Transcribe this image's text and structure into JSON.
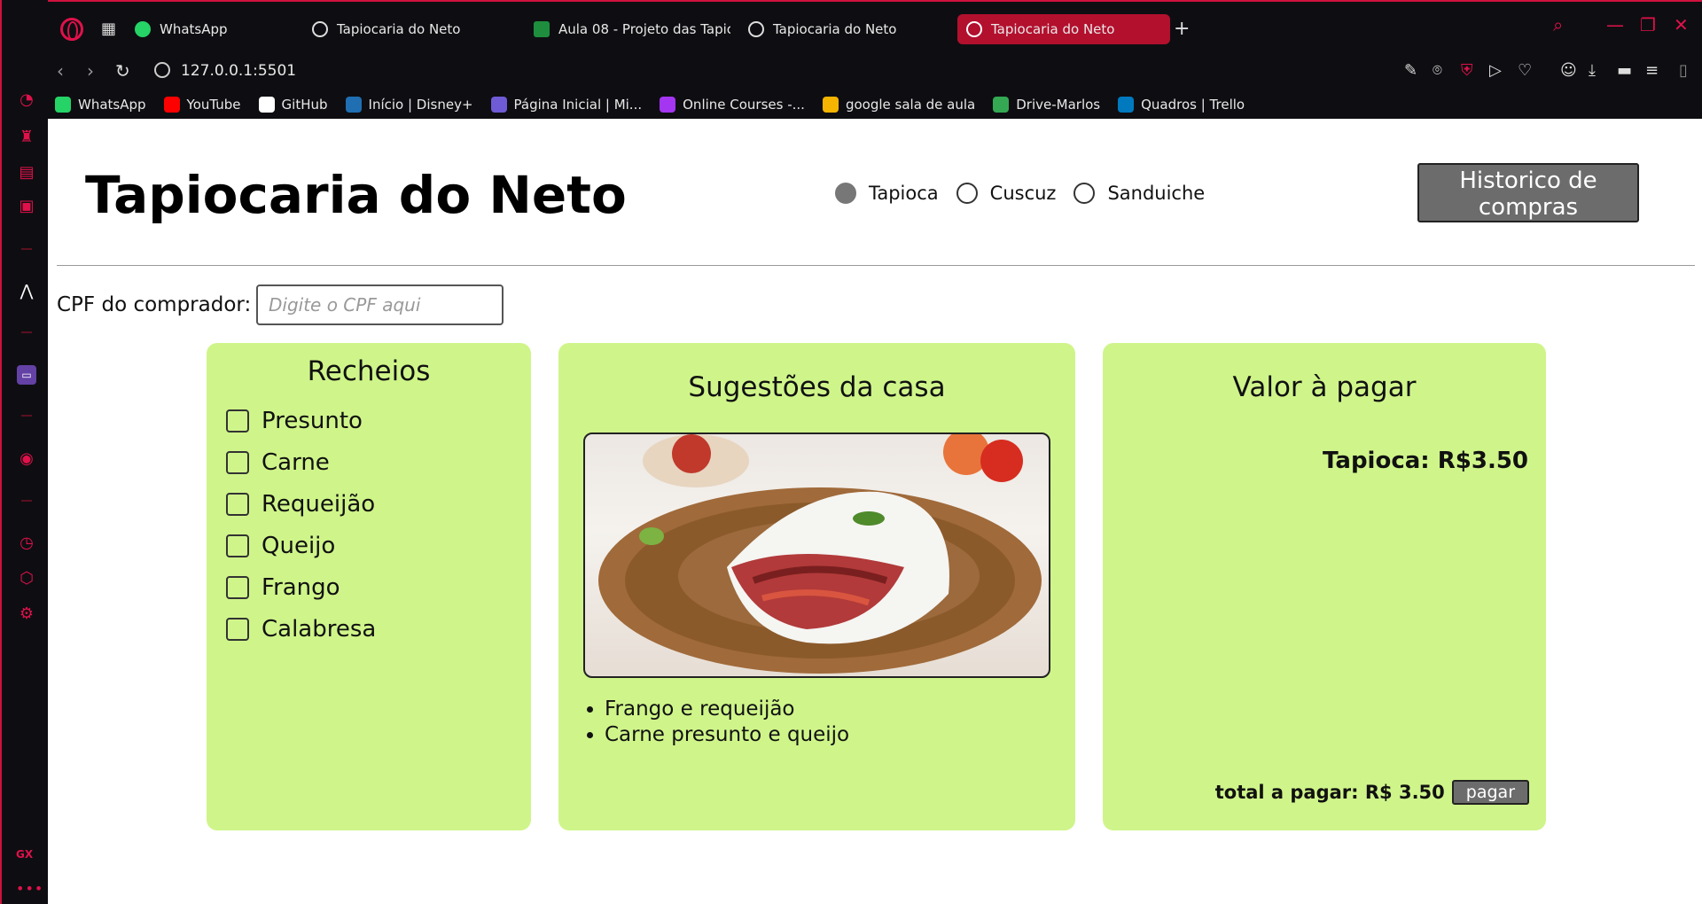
{
  "browser": {
    "tabs": [
      {
        "label": "WhatsApp",
        "icon": "whatsapp-icon",
        "active": false
      },
      {
        "label": "Tapiocaria do Neto",
        "icon": "globe-icon",
        "active": false
      },
      {
        "label": "Aula 08 - Projeto das Tapic",
        "icon": "classroom-icon",
        "active": false
      },
      {
        "label": "Tapiocaria do Neto",
        "icon": "globe-icon",
        "active": false
      },
      {
        "label": "Tapiocaria do Neto",
        "icon": "globe-icon",
        "active": true
      }
    ],
    "url": "127.0.0.1:5501",
    "bookmarks": [
      {
        "label": "WhatsApp",
        "icon": "whatsapp-icon",
        "color": "#25d366"
      },
      {
        "label": "YouTube",
        "icon": "youtube-icon",
        "color": "#ff0000"
      },
      {
        "label": "GitHub",
        "icon": "github-icon",
        "color": "#ffffff"
      },
      {
        "label": "Início | Disney+",
        "icon": "disney-icon",
        "color": "#1f6fb2"
      },
      {
        "label": "Página Inicial | Mi...",
        "icon": "microsoft-icon",
        "color": "#6f5bd6"
      },
      {
        "label": "Online Courses -...",
        "icon": "udemy-icon",
        "color": "#a435f0"
      },
      {
        "label": "google sala de aula",
        "icon": "classroom-icon",
        "color": "#f4b400"
      },
      {
        "label": "Drive-Marlos",
        "icon": "drive-icon",
        "color": "#34a853"
      },
      {
        "label": "Quadros | Trello",
        "icon": "trello-icon",
        "color": "#0079bf"
      }
    ],
    "accent": "#e0114a"
  },
  "page": {
    "title": "Tapiocaria do Neto",
    "options": [
      {
        "label": "Tapioca",
        "checked": true
      },
      {
        "label": "Cuscuz",
        "checked": false
      },
      {
        "label": "Sanduiche",
        "checked": false
      }
    ],
    "history_button": "Historico de compras",
    "cpf_label": "CPF do comprador:",
    "cpf_placeholder": "Digite o CPF aqui",
    "card_color": "#cff58a"
  },
  "recheios": {
    "title": "Recheios",
    "items": [
      "Presunto",
      "Carne",
      "Requeijão",
      "Queijo",
      "Frango",
      "Calabresa"
    ]
  },
  "sugestoes": {
    "title": "Sugestões da casa",
    "items": [
      "Frango e requeijão",
      "Carne presunto e queijo"
    ]
  },
  "valor": {
    "title": "Valor à pagar",
    "line": "Tapioca: R$3.50",
    "total_label": "total a pagar: R$ 3.50",
    "pay_button": "pagar"
  }
}
